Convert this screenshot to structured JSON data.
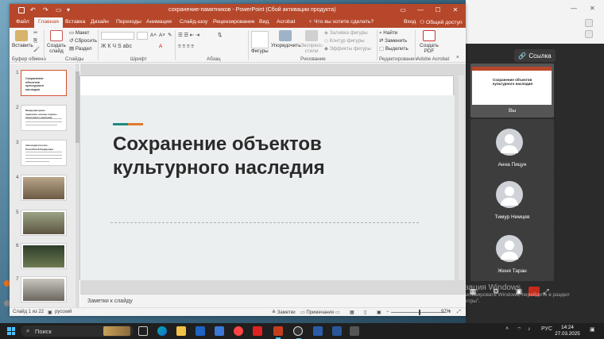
{
  "window": {
    "title": "сохранение-памятников - PowerPoint (Сбой активации продукта)"
  },
  "tabs": [
    "Файл",
    "Главная",
    "Вставка",
    "Дизайн",
    "Переходы",
    "Анимация",
    "Слайд-шоу",
    "Рецензирование",
    "Вид",
    "Acrobat"
  ],
  "tell_me": "Что вы хотите сделать?",
  "sign_in": "Вход",
  "share": "Общий доступ",
  "ribbon": {
    "paste": "Вставить",
    "clipboard_group": "Буфер обмена",
    "new_slide": "Создать слайд",
    "layout": "Макет",
    "reset": "Сбросить",
    "section": "Раздел",
    "slides_group": "Слайды",
    "font_group": "Шрифт",
    "paragraph_group": "Абзац",
    "shapes": "Фигуры",
    "arrange": "Упорядочить",
    "quick_styles": "Экспресс-стили",
    "shape_fill": "Заливка фигуры",
    "shape_outline": "Контур фигуры",
    "shape_effects": "Эффекты фигуры",
    "drawing_group": "Рисование",
    "find": "Найти",
    "replace": "Заменить",
    "select": "Выделить",
    "editing_group": "Редактирование",
    "create_pdf": "Создать PDF",
    "acrobat_group": "Adobe Acrobat",
    "format_glyphs": "Ж К Ч S abc"
  },
  "slides": [
    {
      "num": "1",
      "title": "Сохранение объектов культурного наследия"
    },
    {
      "num": "2",
      "title": "Международные правовые основы охраны культурного наследия"
    },
    {
      "num": "3",
      "title": "Законодательство Российской Федерации"
    },
    {
      "num": "4"
    },
    {
      "num": "5"
    },
    {
      "num": "6"
    },
    {
      "num": "7"
    }
  ],
  "main_slide": {
    "title": "Сохранение объектов культурного наследия",
    "accent_colors": [
      "#1e8a80",
      "#e07a2f"
    ]
  },
  "notes_placeholder": "Заметки к слайду",
  "status": {
    "slide_counter": "Слайд 1 из 22",
    "language": "русский",
    "notes": "Заметки",
    "comments": "Примечания",
    "zoom": "97%"
  },
  "meeting": {
    "link_button": "Ссылка",
    "self_label": "Вы",
    "self_slide_title": "Сохранение объектов культурного наследия",
    "participants": [
      {
        "name": "Анна Пицун"
      },
      {
        "name": "Тимур Немцев"
      },
      {
        "name": "Женя Таран"
      }
    ]
  },
  "watermark": {
    "line1": "Активация Windows",
    "line2": "Чтобы активировать Windows, перейдите в раздел",
    "line3": "\"Параметры\"."
  },
  "taskbar": {
    "search": "Поиск",
    "language": "РУС",
    "time": "14:24",
    "date": "27.03.2025"
  }
}
